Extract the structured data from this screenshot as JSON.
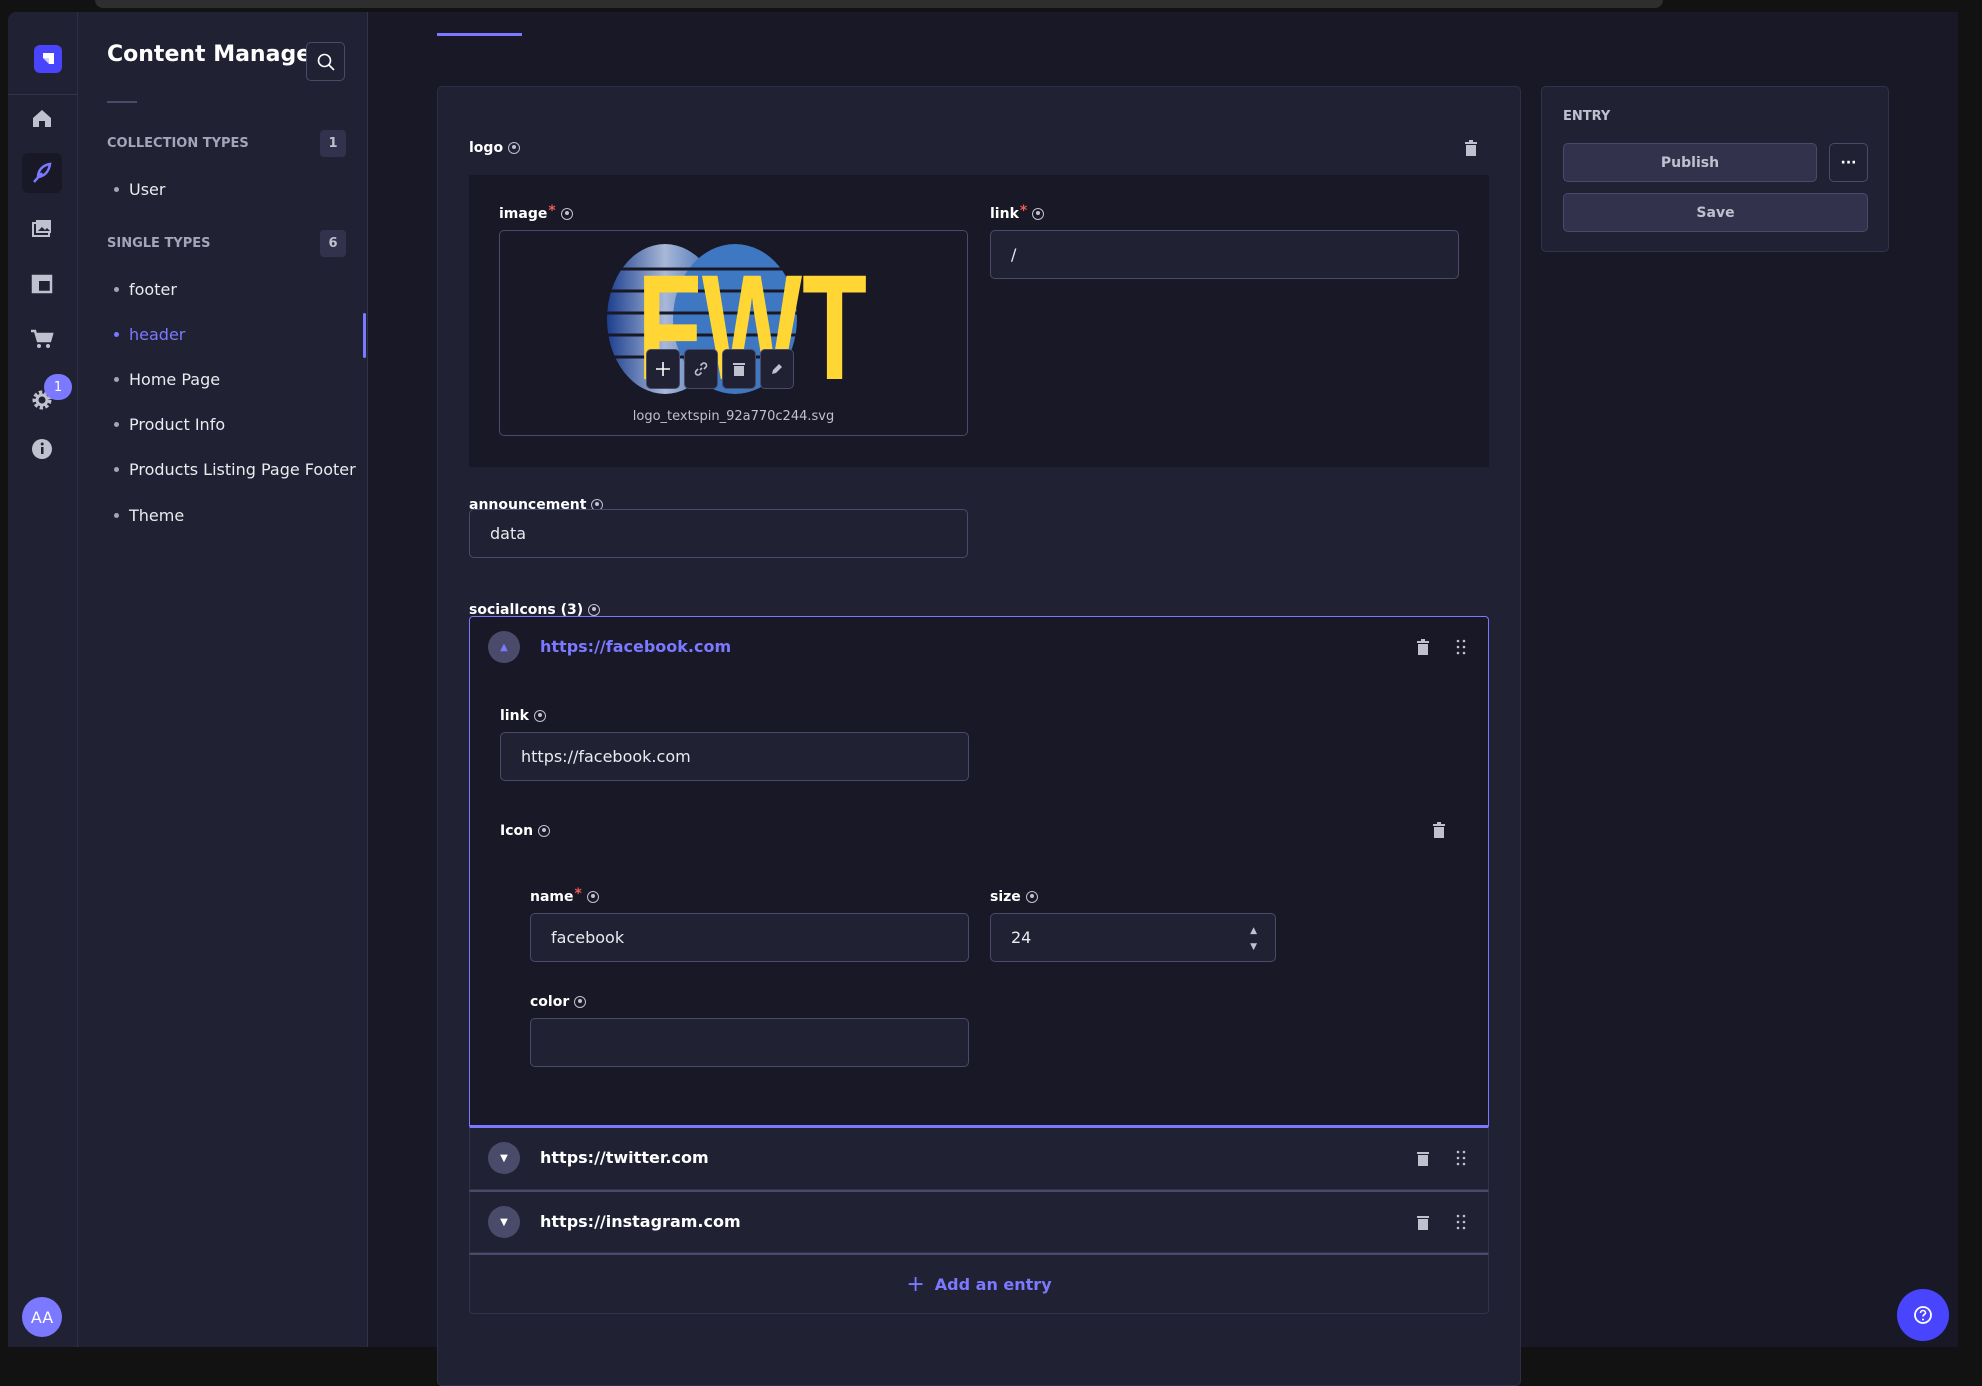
{
  "sidebar": {
    "title": "Content Manager",
    "collection_label": "COLLECTION TYPES",
    "collection_count": "1",
    "collection_items": [
      "User"
    ],
    "single_label": "SINGLE TYPES",
    "single_count": "6",
    "single_items": [
      "footer",
      "header",
      "Home Page",
      "Product Info",
      "Products Listing Page Footer",
      "Theme"
    ],
    "active_item": "header",
    "notification_count": "1",
    "avatar_initials": "AA"
  },
  "form": {
    "logo_label": "logo",
    "image_label": "image",
    "image_filename": "logo_textspin_92a770c244.svg",
    "image_logo_text": "FWT",
    "link_label": "link",
    "link_value": "/",
    "announcement_label": "announcement",
    "announcement_value": "data",
    "social_label": "socialIcons (3)",
    "social": [
      {
        "title": "https://facebook.com",
        "expanded": true,
        "link_label": "link",
        "link_value": "https://facebook.com",
        "icon_label": "Icon",
        "name_label": "name",
        "name_value": "facebook",
        "size_label": "size",
        "size_value": "24",
        "color_label": "color",
        "color_value": ""
      },
      {
        "title": "https://twitter.com",
        "expanded": false
      },
      {
        "title": "https://instagram.com",
        "expanded": false
      }
    ],
    "add_entry": "Add an entry"
  },
  "entry": {
    "label": "ENTRY",
    "publish": "Publish",
    "save": "Save",
    "more": "···"
  },
  "colors": {
    "accent": "#7b79ff",
    "primary": "#4945ff",
    "bg": "#181826",
    "surface": "#212134",
    "required": "#ee5e52"
  }
}
